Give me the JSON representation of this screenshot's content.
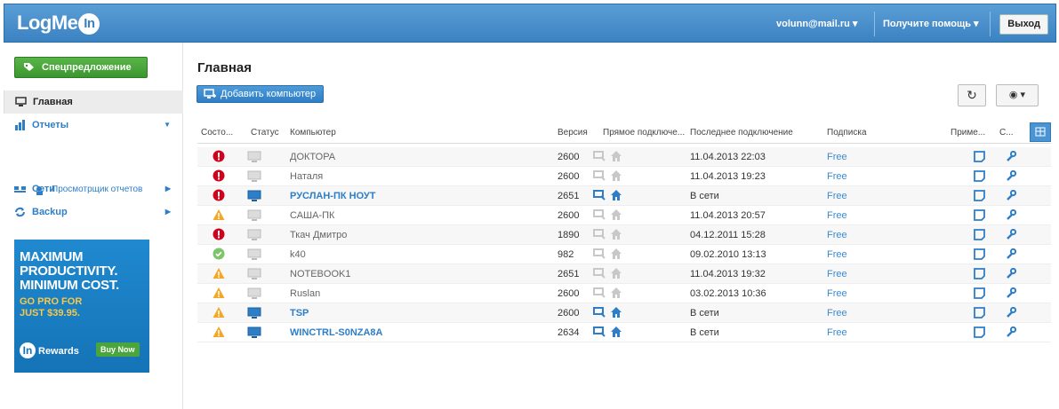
{
  "header": {
    "logo": "LogMe",
    "logo_in": "In",
    "user_email": "volunn@mail.ru ▾",
    "help_label": "Получите помощь ▾",
    "logout_label": "Выход"
  },
  "sidebar": {
    "promo_label": "Спецпредложение",
    "items": [
      {
        "label": "Главная",
        "icon": "monitor-icon"
      },
      {
        "label": "Отчеты",
        "icon": "bar-chart-icon"
      },
      {
        "label": "Сети",
        "icon": "network-icon"
      },
      {
        "label": "Backup",
        "icon": "sync-icon"
      }
    ],
    "sub_item_label": "Просмотрщик отчетов",
    "banner": {
      "line1a": "MAXIMUM",
      "line1b": "PRODUCTIVITY.",
      "line1c": "MINIMUM COST.",
      "line2a": "GO PRO FOR",
      "line2b": "JUST $39.95.",
      "rewards": "Rewards",
      "rewards_in": "In",
      "buy_now": "Buy Now"
    }
  },
  "main": {
    "title": "Главная",
    "add_computer_label": "Добавить компьютер",
    "refresh_glyph": "↻",
    "view_glyph": "◉ ▾",
    "columns": [
      "Состо...",
      "Статус",
      "Компьютер",
      "Версия",
      "Прямое подключе...",
      "Последнее подключение",
      "Подписка",
      "Приме...",
      "С..."
    ],
    "rows": [
      {
        "state": "error",
        "online": false,
        "name": "ДОКТОРА",
        "version": "2600",
        "last": "11.04.2013 22:03",
        "plan": "Free"
      },
      {
        "state": "error",
        "online": false,
        "name": "Наталя",
        "version": "2600",
        "last": "11.04.2013 19:23",
        "plan": "Free"
      },
      {
        "state": "error",
        "online": true,
        "name": "РУСЛАН-ПК НОУТ",
        "version": "2651",
        "last": "В сети",
        "plan": "Free"
      },
      {
        "state": "warning",
        "online": false,
        "name": "САША-ПК",
        "version": "2600",
        "last": "11.04.2013 20:57",
        "plan": "Free"
      },
      {
        "state": "error",
        "online": false,
        "name": "Ткач Дмитро",
        "version": "1890",
        "last": "04.12.2011 15:28",
        "plan": "Free"
      },
      {
        "state": "ok",
        "online": false,
        "name": "k40",
        "version": "982",
        "last": "09.02.2010 13:13",
        "plan": "Free"
      },
      {
        "state": "warning",
        "online": false,
        "name": "NOTEBOOK1",
        "version": "2651",
        "last": "11.04.2013 19:32",
        "plan": "Free"
      },
      {
        "state": "warning",
        "online": false,
        "name": "Ruslan",
        "version": "2600",
        "last": "03.02.2013 10:36",
        "plan": "Free"
      },
      {
        "state": "warning",
        "online": true,
        "name": "TSP",
        "version": "2600",
        "last": "В сети",
        "plan": "Free"
      },
      {
        "state": "warning",
        "online": true,
        "name": "WINCTRL-S0NZA8A",
        "version": "2634",
        "last": "В сети",
        "plan": "Free"
      }
    ]
  },
  "colors": {
    "accent": "#2d7ec7",
    "error": "#d0021b",
    "warning": "#f5a623",
    "ok": "#5cb85c",
    "promo": "#4aa53c"
  }
}
